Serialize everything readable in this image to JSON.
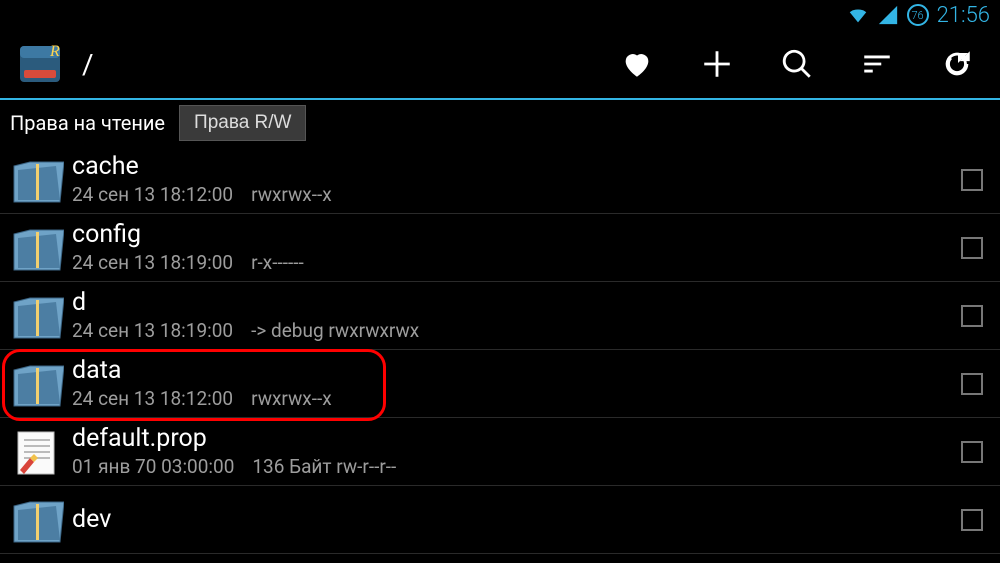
{
  "status": {
    "battery_pct": "76",
    "clock": "21:56"
  },
  "header": {
    "path": "/",
    "app_label": "R"
  },
  "perm": {
    "read_label": "Права на чтение",
    "rw_button": "Права R/W"
  },
  "files": [
    {
      "name": "cache",
      "date": "24 сен 13 18:12:00",
      "extra": "",
      "perm": "rwxrwx--x",
      "type": "folder",
      "highlight": false
    },
    {
      "name": "config",
      "date": "24 сен 13 18:19:00",
      "extra": "",
      "perm": "r-x------",
      "type": "folder",
      "highlight": false
    },
    {
      "name": "d",
      "date": "24 сен 13 18:19:00",
      "extra": "-> debug",
      "perm": "rwxrwxrwx",
      "type": "folder",
      "highlight": false
    },
    {
      "name": "data",
      "date": "24 сен 13 18:12:00",
      "extra": "",
      "perm": "rwxrwx--x",
      "type": "folder",
      "highlight": true
    },
    {
      "name": "default.prop",
      "date": "01 янв 70 03:00:00",
      "extra": "136 Байт",
      "perm": "rw-r--r--",
      "type": "file",
      "highlight": false
    },
    {
      "name": "dev",
      "date": "",
      "extra": "",
      "perm": "",
      "type": "folder",
      "highlight": false
    }
  ]
}
